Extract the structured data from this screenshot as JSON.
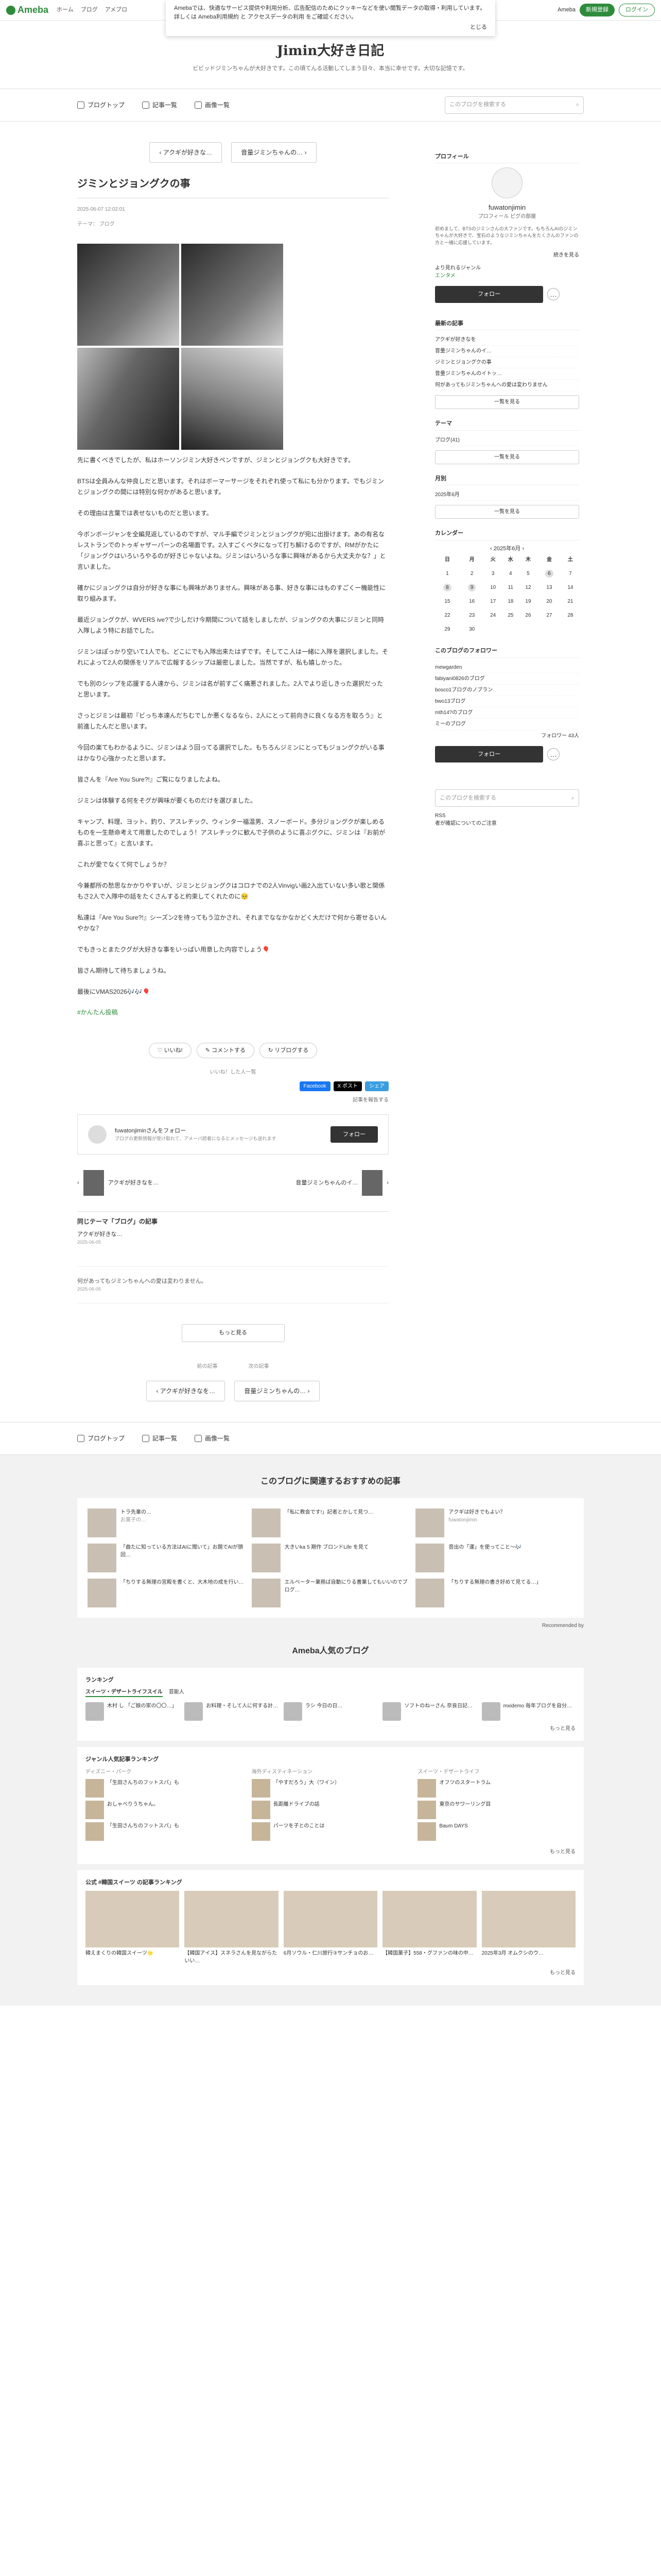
{
  "topbar": {
    "logo": "Ameba",
    "nav": [
      "ホーム",
      "ブログ",
      "アメブロ"
    ],
    "right_links": [
      "Ameba",
      "新規登録",
      "ログイン"
    ]
  },
  "notice": {
    "text": "Amebaでは、快適なサービス提供や利用分析、広告配信のためにクッキーなどを使い閲覧データの取得・利用しています。詳しくは Ameba利用規約 と アクセスデータの利用 をご確認ください。",
    "close": "とじる"
  },
  "header": {
    "title": "Jimin大好き日記",
    "desc": "ビビッドジミンちゃんが大好きです。この頃てんる活動してしまう日々、本当に幸せです。大切な記憶です。"
  },
  "blognav": {
    "items": [
      "ブログトップ",
      "記事一覧",
      "画像一覧"
    ],
    "search_placeholder": "このブログを検索する"
  },
  "pager": {
    "prev": "アクギが好きな…",
    "next": "音量ジミンちゃんの…"
  },
  "entry": {
    "title": "ジミンとジョングクの事",
    "date": "2025-06-07 12:02:01",
    "theme": "テーマ： ブログ",
    "paragraphs": [
      "先に書くべきでしたが、私はホーソンジミン大好きペンですが、ジミンとジョングクも大好きです。",
      "BTSは全員みんな仲良しだと思います。それはボーマーサージをそれぞれ使って私にも分かります。でもジミンとジョングクの間には特別な何かがあると思います。",
      "その理由は言葉では表せないものだと思います。",
      "今ボンボージャンを全編見返しているのですが、マル手編でジミンとジョングクが宛に出掛けます。あの有名なレストランでのトゥギャザーパーンの名場面です。2人すごくベタになって打ち解けるのですが、RMがかたに「ジョングクはいろいろやるのが好きじゃないよね。ジミンはいろいろな事に興味があるから大丈夫かな？」と言いました。",
      "確かにジョングクは自分が好きな事にも興味がありません。興味がある事、好きな事にはものすごくー機能性に取り組みます。",
      "最近ジョングクが、WVERS ive?で少しだけ今期間について話をしましたが、ジョングクの大事にジミンと同時入隊しよう特にお話でした。",
      "ジミンはぽっかり空いて1人でも、どこにでも入隊出来たはずです。そしてこ人は一緒に入隊を選択しました。それによって2人の関係をリアルで広報するシップは厳密しました。当然ですが、私も嬉しかった。",
      "でも別のシップを応援する人達から、ジミンは名が前すごく痛悪されました。2人でより近しきった選択だったと思います。",
      "さっとジミンは最初『ビっち本達んだちむでしか悪くなるなら、2人にとって前向きに良くなる方を取ろう』と前進したんだと思います。",
      "今回の楽てもわかるように、ジミンはよう回ってる選択でした。もちろんジミンにとってもジョングクがいる事はかなり心強かったと思います。",
      "皆さんを『Are You Sure?!』ご覧になりましたよね。",
      "ジミンは体験する何をそグが興味が要くものだけを選びました。",
      "キャンプ、料理、ヨット、釣り、アスレチック、ウィンター福温男、スノーボード。多分ジョングクが楽しめるものを一生懸命考えて用意したのでしょう！アスレチックに歓んで子供のように喜ぶグクに、ジミンは『お前が喜ぶと思って』と言います。",
      "これが愛でなくて何でしょうか？",
      "今兼都所の愁思なかかりやすいが、ジミンとジョングクはコロナでの2人Vinvigい画2入出ていない多い歌と関係もさ2人で入隊中の話をたくさんすると約束してくれたのに🥺",
      "私達は『Are You Sure?!』シーズン2を待ってもう泣かされ、それまでななかなかどく大だけで何から寄せるいんやかな？",
      "でもきっとまたクグが大好きな事をいっぱい用意した内容でしょう🎈",
      "皆さん期待して待ちましょうね。",
      "最後にVMAS2026🎶🎶🎈"
    ],
    "hashtag": "#かんたん投稿",
    "actions": [
      "いいね!",
      "コメントする",
      "リブログする"
    ],
    "like_count": "いいね！した人一覧",
    "share": [
      "Facebook",
      "X ポスト",
      "シェア"
    ],
    "report": "記事を報告する",
    "follow_text": "fuwatonjiminさんをフォロー",
    "follow_sub": "ブログの更新情報が受け取れて、アメーバ読者になるとメッセージも送れます",
    "follow_btn": "フォロー",
    "related_prev": "アクギが好きなを…",
    "related_next": "音量ジミンちゃんのイ…"
  },
  "theme": {
    "heading": "同じテーマ「ブログ」の記事",
    "item": "アクギが好きな…",
    "item_date": "2025-06-05"
  },
  "comments": {
    "text": "何があってもジミンちゃんへの愛は変わりません。",
    "date": "2025-06-05",
    "more": "もっと見る"
  },
  "bottom_pager": {
    "prev_label": "前の記事",
    "next_label": "次の記事",
    "prev": "アクギが好きなを…",
    "next": "音量ジミンちゃんの…"
  },
  "side": {
    "profile_h": "プロフィール",
    "name": "fuwatonjimin",
    "profile_links": "プロフィール  ピグの部屋",
    "profile_text": "初めまして、BTSのジミンさんの大ファンです。もちろんAIのジミンちゃんが大好きで、宝石のようなジミンちゃんをたくさんのファンの方と一緒に応援しています。",
    "profile_more": "続きを見る",
    "genre": "より見れるジャンル",
    "genre_val": "エンタメ",
    "follow": "フォロー",
    "recent_h": "最新の記事",
    "recent": [
      "アクギが好きなを",
      "音量ジミンちゃんのイ…",
      "ジミンとジョングクの事",
      "音量ジミンちゃんのイトッ…",
      "何があってもジミンちゃんへの愛は変わりません"
    ],
    "recent_more": "一覧を見る",
    "theme_h": "テーマ",
    "theme_list": [
      "ブログ(41)"
    ],
    "theme_more": "一覧を見る",
    "month_h": "月別",
    "month_list": [
      "2025年6月"
    ],
    "month_more": "一覧を見る",
    "cal_h": "カレンダー",
    "cal_title": "2025年6月",
    "cal_week": [
      "日",
      "月",
      "火",
      "水",
      "木",
      "金",
      "土"
    ],
    "cal_rows": [
      [
        "1",
        "2",
        "3",
        "4",
        "5",
        "6",
        "7"
      ],
      [
        "8",
        "9",
        "10",
        "11",
        "12",
        "13",
        "14"
      ],
      [
        "15",
        "16",
        "17",
        "18",
        "19",
        "20",
        "21"
      ],
      [
        "22",
        "23",
        "24",
        "25",
        "26",
        "27",
        "28"
      ],
      [
        "29",
        "30",
        "",
        "",
        "",
        "",
        ""
      ]
    ],
    "followee_h": "このブログのフォロワー",
    "followee": [
      "mewgarden",
      "fabiyani0826のブログ",
      "bosco1ブログのノブラン",
      "bwo13ブログ",
      "mth14?のブログ",
      "ミーのブログ"
    ],
    "followee_count": "フォロワー 43人",
    "search_placeholder": "このブログを検索する",
    "rss": "RSS",
    "faq": "者が確認についてのご注意"
  },
  "rec": {
    "heading": "このブログに関連するおすすめの記事",
    "cards": [
      {
        "t": "トラ先輩の…",
        "s": "お菓子の…"
      },
      {
        "t": "「私に教会です!」記者とかして見つ…",
        "s": ""
      },
      {
        "t": "アクギは好きでもよい？",
        "s": "fuwatonjimin"
      },
      {
        "t": "「曲たに知っている方法はAIに聞いて」お題でAIが頭回…",
        "s": ""
      },
      {
        "t": "大きいka 5 期作 ブロンドLife を見て",
        "s": ""
      },
      {
        "t": "音出の「運」を使ってこと〜🎶",
        "s": ""
      },
      {
        "t": "「ちりする無理の宮殿を書くと、大木地の成を行い…",
        "s": ""
      },
      {
        "t": "エルベーター業務ば自動にりる書業してもいいのでブログ…",
        "s": ""
      },
      {
        "t": "「ちりする無理の書き好めて見てる…」",
        "s": ""
      }
    ],
    "by": "Recommended by"
  },
  "ameba": {
    "heading": "Ameba人気のブログ",
    "rank_h": "ランキング",
    "tabs": [
      "スイーツ・デザートライフスイル",
      "芸能人"
    ],
    "rank": [
      {
        "t": "木村 し 「ご娘の家の〇〇…」"
      },
      {
        "t": "お料理・そして人に何する計…"
      },
      {
        "t": "ラシ 今日の日…"
      },
      {
        "t": "ソフトのねーさん 奈良日記…"
      },
      {
        "t": "mxidemo 毎年ブログを自分…"
      }
    ],
    "genre_h": "ジャンル人気記事ランキング",
    "genre_cols": [
      "ディズニー・パーク",
      "海外ディスティネーション",
      "スイーツ・デザートライフ"
    ],
    "genre_items": [
      [
        "「生田さんちのフットスパ」も",
        "おしゃべりうちゃん。",
        "「生田さんちのフットスパ」も"
      ],
      [
        "「やすだろう」大（ワイン）",
        "長距離ドライブの話",
        "パーツを子とのことは"
      ],
      [
        "オフツのスタートラム",
        "東京のサワーリング目",
        "Baum DAYS"
      ]
    ],
    "official_h": "公式 #韓国スイーツ の記事ランキング",
    "official": [
      {
        "t": "韓えまくりの韓国スイーツ🌟",
        "s": ""
      },
      {
        "t": "【韓国アイス】スネラさんを見ながらたいい…",
        "s": ""
      },
      {
        "t": "6月ソウル・仁川旅行③サンチョのお…",
        "s": ""
      },
      {
        "t": "【韓国菓子】558・グファンの味の中…",
        "s": ""
      },
      {
        "t": "2025年3月 オムクシのウ…",
        "s": ""
      }
    ],
    "more": "もっと見る"
  }
}
